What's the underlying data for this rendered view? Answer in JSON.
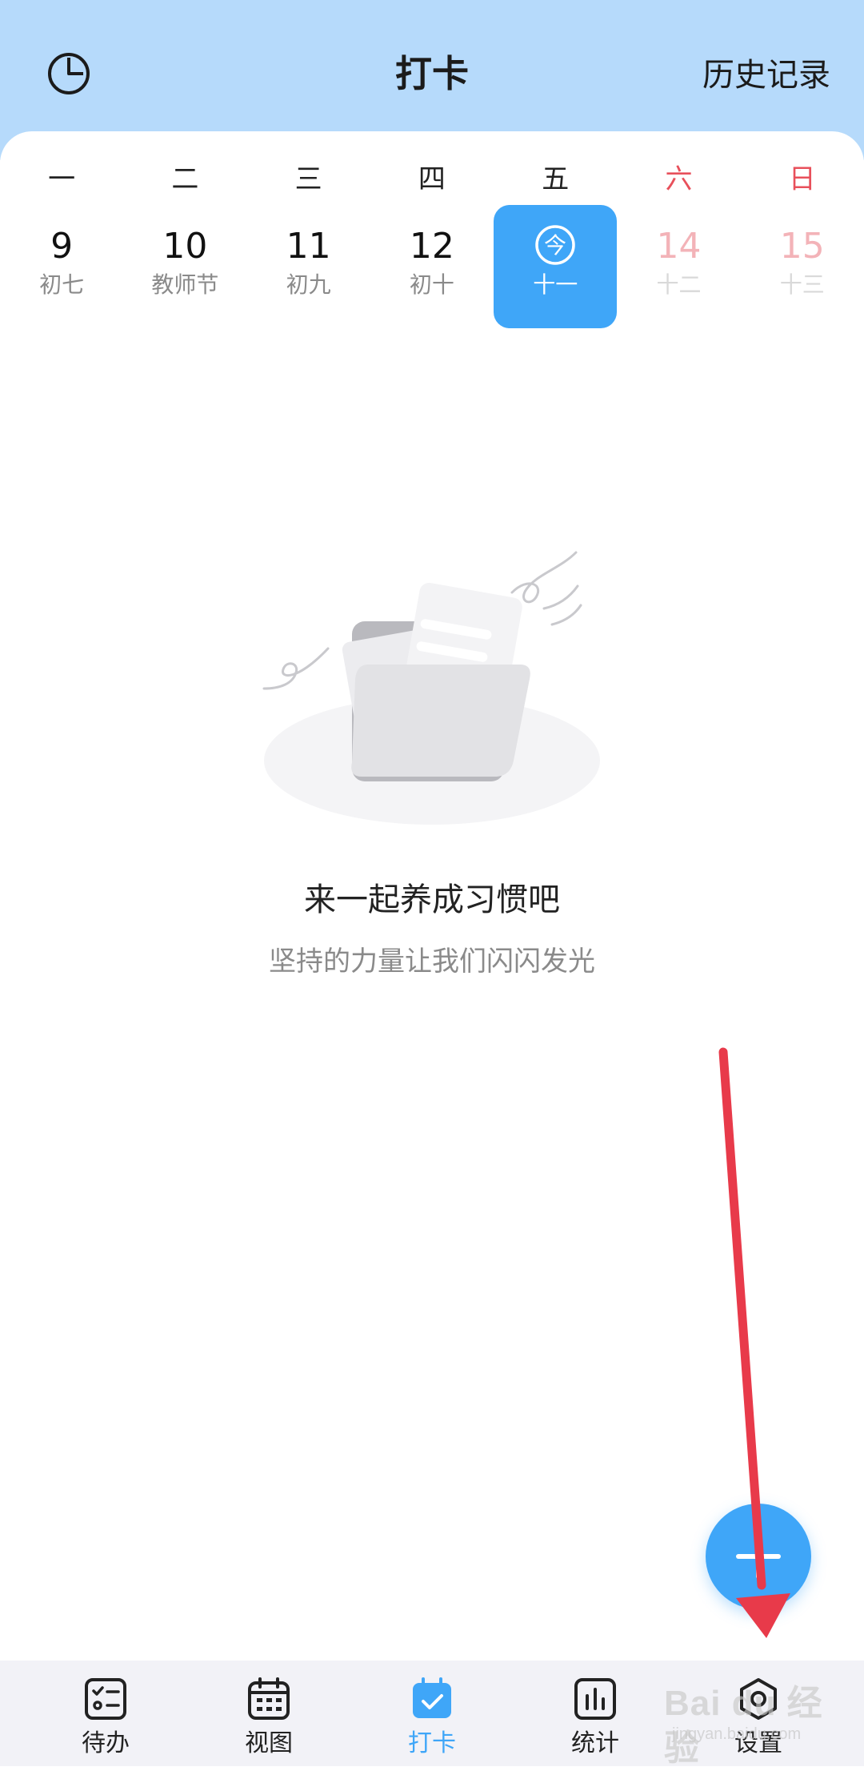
{
  "header": {
    "title": "打卡",
    "history_label": "历史记录",
    "background": "#b6dafb"
  },
  "calendar": {
    "weekdays": [
      "一",
      "二",
      "三",
      "四",
      "五",
      "六",
      "日"
    ],
    "days": [
      {
        "num": "9",
        "lunar": "初七",
        "state": "past"
      },
      {
        "num": "10",
        "lunar": "教师节",
        "state": "past"
      },
      {
        "num": "11",
        "lunar": "初九",
        "state": "past"
      },
      {
        "num": "12",
        "lunar": "初十",
        "state": "past"
      },
      {
        "num": "今",
        "lunar": "十一",
        "state": "today"
      },
      {
        "num": "14",
        "lunar": "十二",
        "state": "future"
      },
      {
        "num": "15",
        "lunar": "十三",
        "state": "future"
      }
    ],
    "accent": "#3fa6f8",
    "weekend_color": "#e8505b"
  },
  "empty_state": {
    "title": "来一起养成习惯吧",
    "subtitle": "坚持的力量让我们闪闪发光"
  },
  "fab": {
    "icon": "plus-icon"
  },
  "tabbar": {
    "tabs": [
      {
        "label": "待办",
        "icon": "todo-list-icon",
        "active": false
      },
      {
        "label": "视图",
        "icon": "calendar-view-icon",
        "active": false
      },
      {
        "label": "打卡",
        "icon": "checkin-icon",
        "active": true
      },
      {
        "label": "统计",
        "icon": "stats-icon",
        "active": false
      },
      {
        "label": "设置",
        "icon": "settings-icon",
        "active": false
      }
    ]
  },
  "watermark": {
    "main": "Bai du 经验",
    "sub": "jingyan.baidu.com"
  }
}
